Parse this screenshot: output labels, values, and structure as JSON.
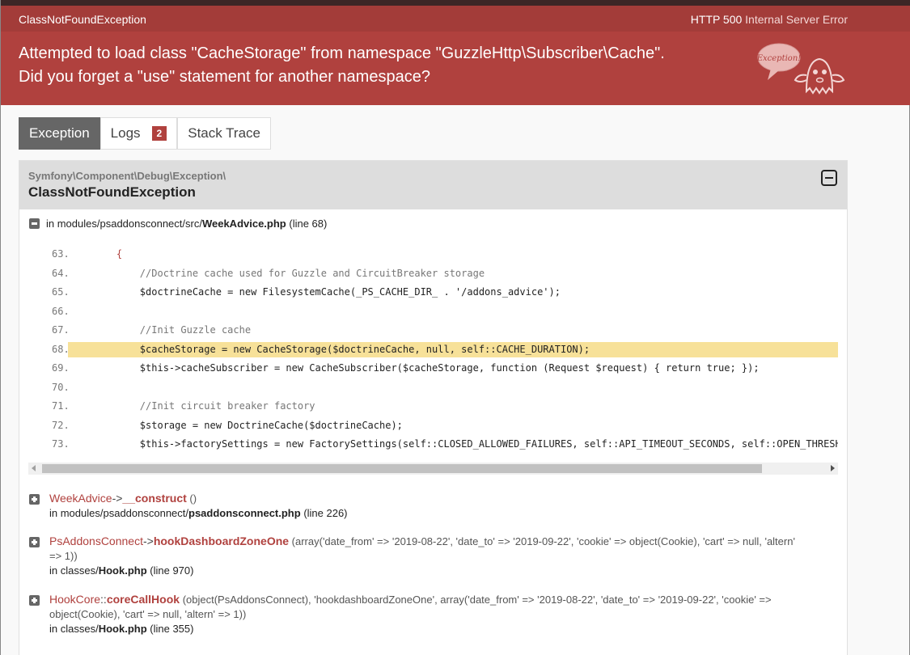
{
  "header": {
    "exception_class": "ClassNotFoundException",
    "status_code": "HTTP 500",
    "status_text": "Internal Server Error",
    "message_line1": "Attempted to load class \"CacheStorage\" from namespace \"GuzzleHttp\\Subscriber\\Cache\".",
    "message_line2": "Did you forget a \"use\" statement for another namespace?",
    "mascot_text": "Exception!"
  },
  "tabs": [
    {
      "label": "Exception",
      "active": true
    },
    {
      "label": "Logs",
      "badge": "2"
    },
    {
      "label": "Stack Trace"
    }
  ],
  "exception": {
    "namespace": "Symfony\\Component\\Debug\\Exception\\",
    "name": "ClassNotFoundException",
    "location_prefix": "in modules/psaddonsconnect/src/",
    "location_file": "WeekAdvice.php",
    "location_line": "(line 68)"
  },
  "code_lines": [
    {
      "num": "63.",
      "text": "    {"
    },
    {
      "num": "64.",
      "text": "        //Doctrine cache used for Guzzle and CircuitBreaker storage"
    },
    {
      "num": "65.",
      "text": "        $doctrineCache = new FilesystemCache(_PS_CACHE_DIR_ . '/addons_advice');"
    },
    {
      "num": "66.",
      "text": ""
    },
    {
      "num": "67.",
      "text": "        //Init Guzzle cache"
    },
    {
      "num": "68.",
      "text": "        $cacheStorage = new CacheStorage($doctrineCache, null, self::CACHE_DURATION);",
      "highlight": true
    },
    {
      "num": "69.",
      "text": "        $this->cacheSubscriber = new CacheSubscriber($cacheStorage, function (Request $request) { return true; });"
    },
    {
      "num": "70.",
      "text": ""
    },
    {
      "num": "71.",
      "text": "        //Init circuit breaker factory"
    },
    {
      "num": "72.",
      "text": "        $storage = new DoctrineCache($doctrineCache);"
    },
    {
      "num": "73.",
      "text": "        $this->factorySettings = new FactorySettings(self::CLOSED_ALLOWED_FAILURES, self::API_TIMEOUT_SECONDS, self::OPEN_THRESHOLD_"
    }
  ],
  "trace": [
    {
      "class": "WeekAdvice",
      "arrow": "->",
      "method": "__construct",
      "args_l1": "()",
      "args_l2": "",
      "in_prefix": "in modules/psaddonsconnect/",
      "in_file": "psaddonsconnect.php",
      "in_line": "(line 226)"
    },
    {
      "class": "PsAddonsConnect",
      "arrow": "->",
      "method": "hookDashboardZoneOne",
      "args_l1": "(array('date_from' => '2019-08-22', 'date_to' => '2019-09-22', 'cookie' => object(Cookie), 'cart' => null, 'altern'",
      "args_l2": "=> 1))",
      "in_prefix": "in classes/",
      "in_file": "Hook.php",
      "in_line": "(line 970)"
    },
    {
      "class": "HookCore",
      "arrow": "::",
      "method": "coreCallHook",
      "args_l1": "(object(PsAddonsConnect), 'hookdashboardZoneOne', array('date_from' => '2019-08-22', 'date_to' => '2019-09-22', 'cookie' =>",
      "args_l2": "object(Cookie), 'cart' => null, 'altern' => 1))",
      "in_prefix": "in classes/",
      "in_file": "Hook.php",
      "in_line": "(line 355)"
    }
  ],
  "colors": {
    "header": "#b0413e",
    "highlight": "#f7e199",
    "tab_active": "#666666"
  }
}
